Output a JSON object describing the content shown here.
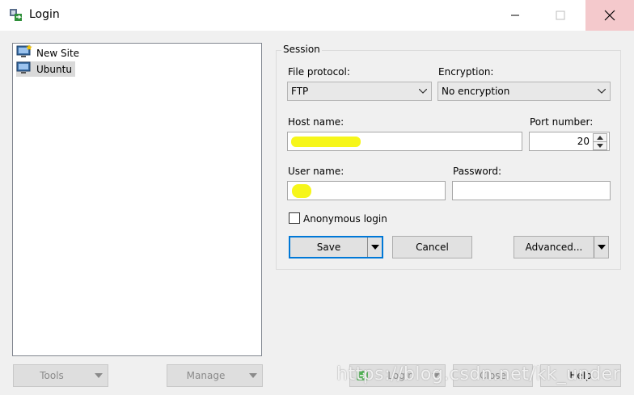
{
  "window": {
    "title": "Login"
  },
  "sites": [
    {
      "label": "New Site"
    },
    {
      "label": "Ubuntu"
    }
  ],
  "left_buttons": {
    "tools": "Tools",
    "manage": "Manage"
  },
  "session": {
    "group_label": "Session",
    "file_protocol_label": "File protocol:",
    "file_protocol_value": "FTP",
    "encryption_label": "Encryption:",
    "encryption_value": "No encryption",
    "host_label": "Host name:",
    "port_label": "Port number:",
    "port_value": "20",
    "user_label": "User name:",
    "password_label": "Password:",
    "anonymous_label": "Anonymous login",
    "anonymous_checked": false,
    "save_label": "Save",
    "cancel_label": "Cancel",
    "advanced_label": "Advanced..."
  },
  "bottom_buttons": {
    "login": "Login",
    "close": "Close",
    "help": "Help"
  },
  "watermark": "https://blog.csdn.net/kk_under",
  "colors": {
    "accent": "#0078d7",
    "highlight": "#f6f61a",
    "close_hover": "#f4c9cc"
  }
}
